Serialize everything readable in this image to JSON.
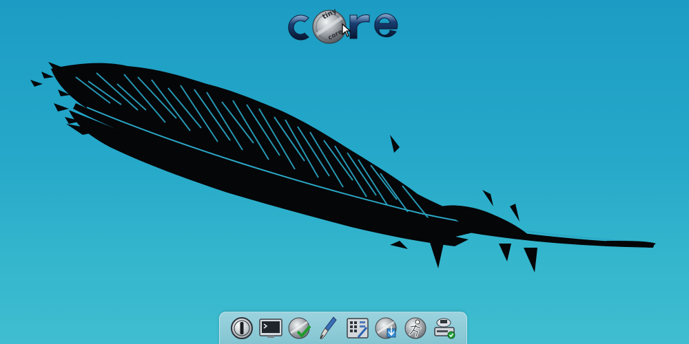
{
  "desktop": {
    "background_top": "#1c9cc4",
    "background_bottom": "#40bdd0"
  },
  "logo": {
    "word": "core",
    "badge_top": "tiny",
    "badge_bottom": "core",
    "colors": {
      "letters": "#0e2a55",
      "letters_edge": "#7fa0c4",
      "badge": "#8a9096"
    }
  },
  "wallpaper": {
    "icon": "feather-icon",
    "ink": "#050608"
  },
  "dock": {
    "items": [
      {
        "icon": "power-icon"
      },
      {
        "icon": "terminal-icon"
      },
      {
        "icon": "apps-checkmark-icon"
      },
      {
        "icon": "paintbrush-icon"
      },
      {
        "icon": "control-panel-icon"
      },
      {
        "icon": "install-disc-icon"
      },
      {
        "icon": "runner-icon"
      },
      {
        "icon": "mount-drive-icon"
      }
    ]
  },
  "cursor": {
    "icon": "arrow-cursor-icon"
  }
}
